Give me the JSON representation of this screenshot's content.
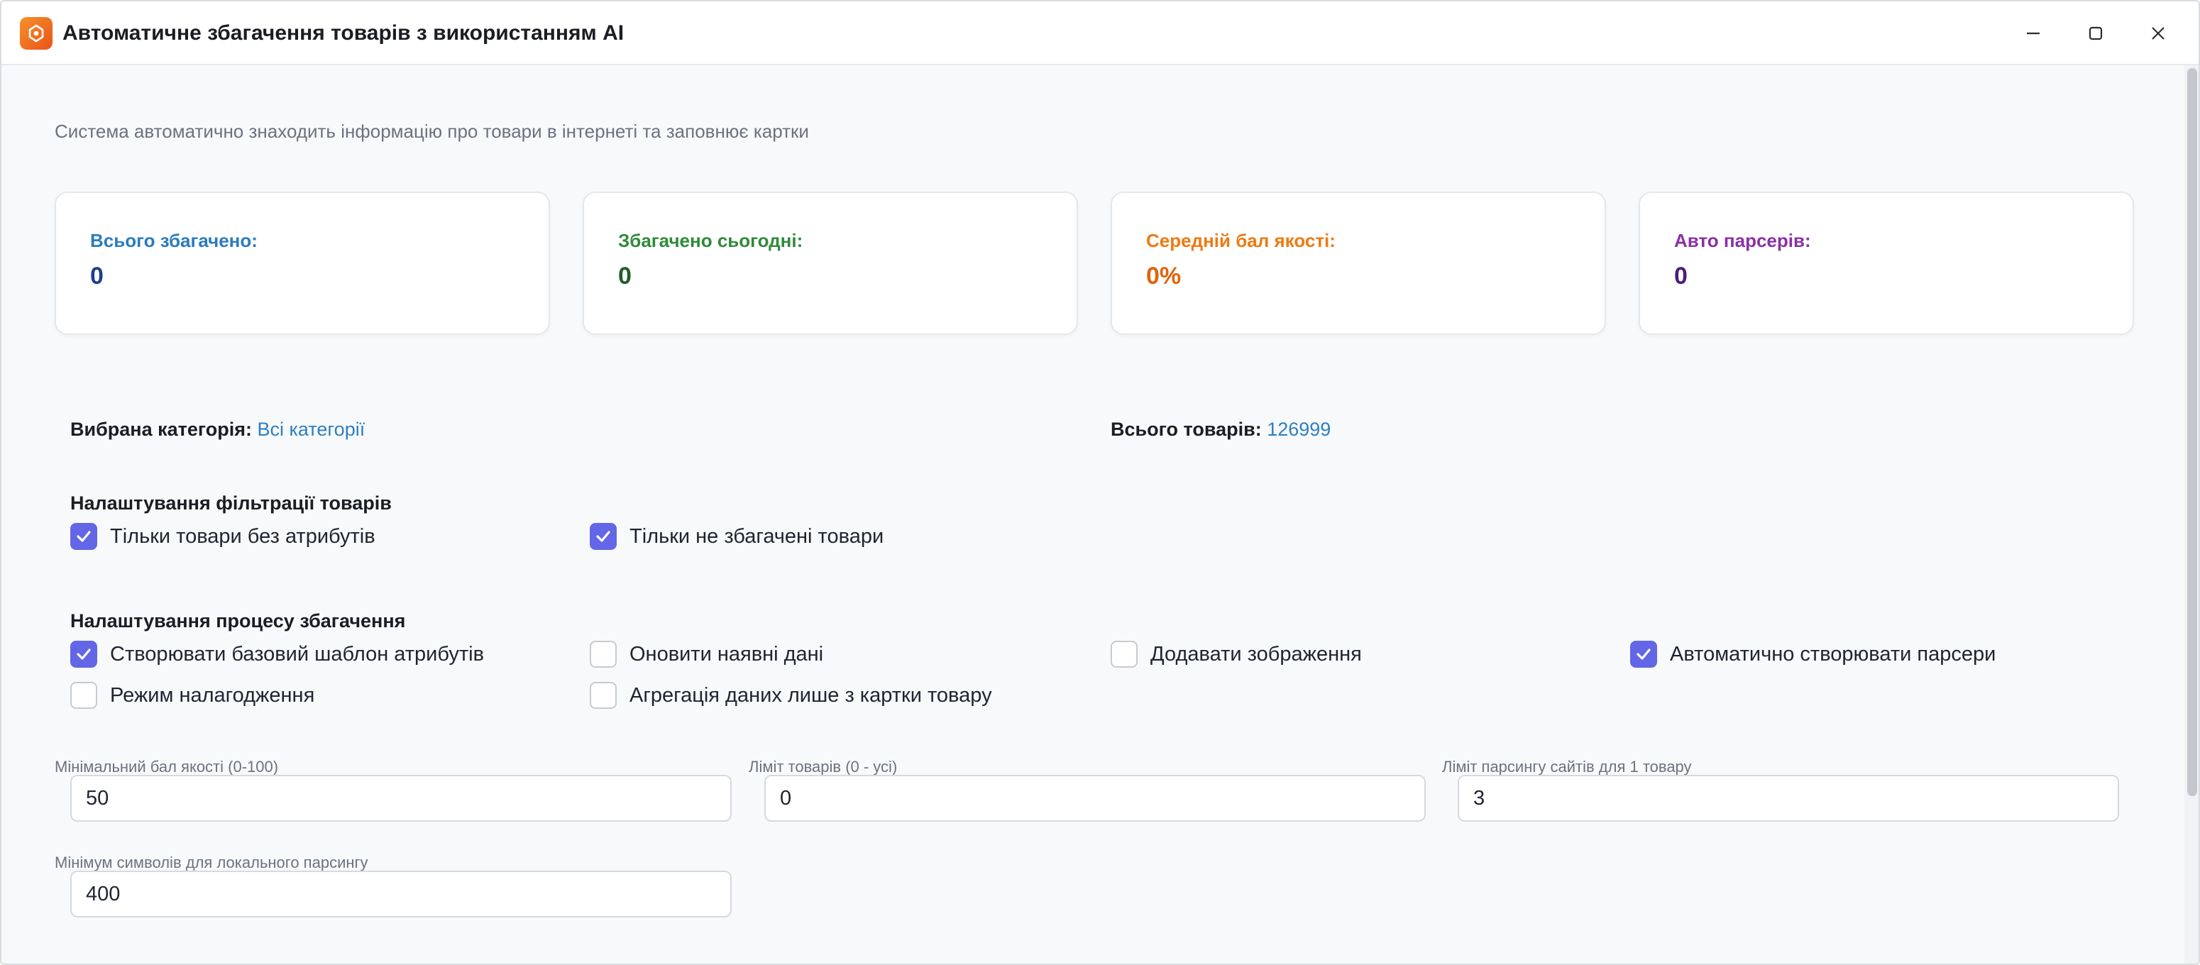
{
  "window": {
    "title": "Автоматичне збагачення товарів з використанням AI"
  },
  "subtitle": "Система автоматично знаходить інформацію про товари в інтернеті та заповнює картки",
  "stats": [
    {
      "label": "Всього збагачено:",
      "value": "0",
      "color": "#2b7bbf",
      "value_color": "#1b3f8f"
    },
    {
      "label": "Збагачено сьогодні:",
      "value": "0",
      "color": "#2f8a3a",
      "value_color": "#1e5e26"
    },
    {
      "label": "Середній бал якості:",
      "value": "0%",
      "color": "#ee7a12",
      "value_color": "#e2620c"
    },
    {
      "label": "Авто парсерів:",
      "value": "0",
      "color": "#8a2fa8",
      "value_color": "#4b1c78"
    }
  ],
  "info": {
    "category_label": "Вибрана категорія:",
    "category_value": "Всі категорії",
    "total_label": "Всього товарів:",
    "total_value": "126999"
  },
  "filter": {
    "title": "Налаштування фільтрації товарів",
    "options": [
      {
        "label": "Тільки товари без атрибутів",
        "checked": true
      },
      {
        "label": "Тільки не збагачені товари",
        "checked": true
      }
    ]
  },
  "process": {
    "title": "Налаштування процесу збагачення",
    "options": [
      {
        "label": "Створювати базовий шаблон атрибутів",
        "checked": true
      },
      {
        "label": "Оновити наявні дані",
        "checked": false
      },
      {
        "label": "Додавати зображення",
        "checked": false
      },
      {
        "label": "Автоматично створювати парсери",
        "checked": true
      },
      {
        "label": "Режим налагодження",
        "checked": false
      },
      {
        "label": "Агрегація даних лише з картки товару",
        "checked": false
      }
    ]
  },
  "fields": [
    {
      "label": "Мінімальний бал якості (0-100)",
      "value": "50"
    },
    {
      "label": "Ліміт товарів (0 - усі)",
      "value": "0"
    },
    {
      "label": "Ліміт парсингу сайтів для 1 товару",
      "value": "3"
    },
    {
      "label": "Мінімум символів для локального парсингу",
      "value": "400"
    }
  ],
  "colors": {
    "accent": "#6366e6",
    "link": "#2e7fc0"
  }
}
